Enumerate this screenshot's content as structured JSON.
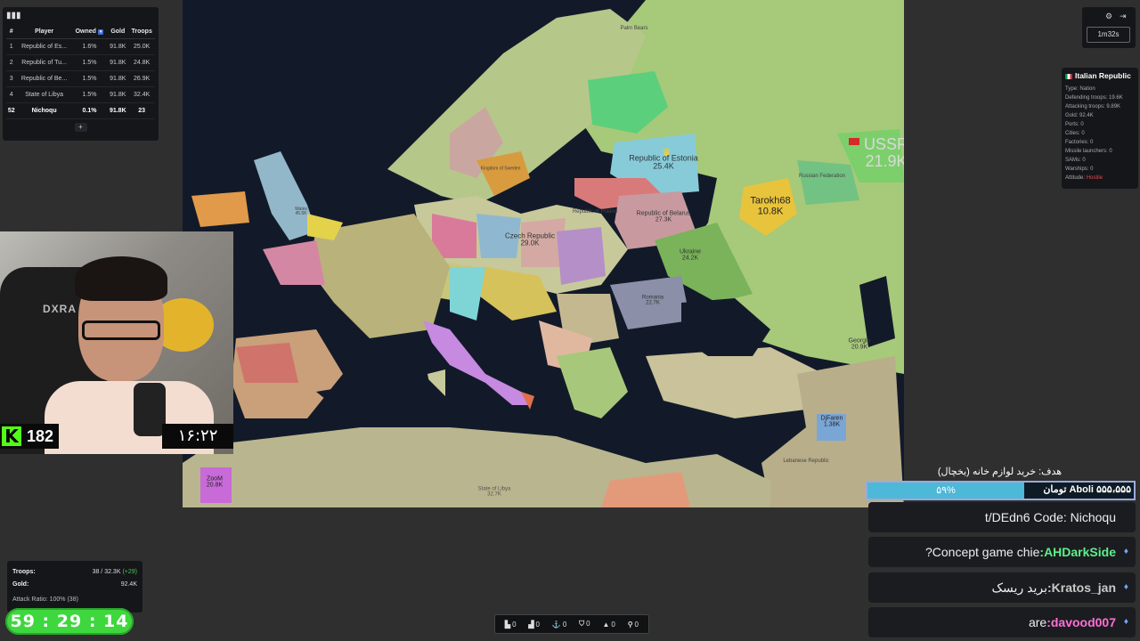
{
  "leaderboard": {
    "headers": {
      "rank": "#",
      "player": "Player",
      "owned": "Owned",
      "gold": "Gold",
      "troops": "Troops"
    },
    "rows": [
      {
        "rank": "1",
        "player": "Republic of Es...",
        "owned": "1.6%",
        "gold": "91.8K",
        "troops": "25.0K"
      },
      {
        "rank": "2",
        "player": "Republic of Tu...",
        "owned": "1.5%",
        "gold": "91.8K",
        "troops": "24.8K"
      },
      {
        "rank": "3",
        "player": "Republic of Be...",
        "owned": "1.5%",
        "gold": "91.8K",
        "troops": "26.9K"
      },
      {
        "rank": "4",
        "player": "State of Libya",
        "owned": "1.5%",
        "gold": "91.8K",
        "troops": "32.4K"
      },
      {
        "rank": "52",
        "player": "Nichoqu",
        "owned": "0.1%",
        "gold": "91.8K",
        "troops": "23"
      }
    ],
    "more": "+"
  },
  "webcam": {
    "kick_count": "182",
    "clock": "۱۶:۲۲",
    "chair_brand": "DXRA"
  },
  "top_controls": {
    "timer": "1m32s"
  },
  "nation_panel": {
    "title": "Italian Republic",
    "rows": [
      "Type: Nation",
      "Defending troops: 19.6K",
      "Attacking troops: 9.89K",
      "Gold: 92.4K",
      "Ports: 0",
      "Cities: 0",
      "Factories: 0",
      "Missile launchers: 0",
      "SAMs: 0",
      "Warships: 0"
    ],
    "attitude_label": "Attitude: ",
    "attitude_value": "Hostile",
    "attitude_color": "#e04848"
  },
  "stats": {
    "troops_label": "Troops:",
    "troops_value": "38 / 32.3K",
    "troops_delta": "(+29)",
    "gold_label": "Gold:",
    "gold_value": "92.4K",
    "attack_ratio": "Attack Ratio: 100% (38)"
  },
  "stream_timer": "59 : 29 : 14",
  "build_bar": [
    {
      "icon": "city-icon",
      "glyph": "▙",
      "count": "0"
    },
    {
      "icon": "factory-icon",
      "glyph": "▟",
      "count": "0"
    },
    {
      "icon": "port-icon",
      "glyph": "⚓",
      "count": "0"
    },
    {
      "icon": "defense-post-icon",
      "glyph": "⛉",
      "count": "0"
    },
    {
      "icon": "missile-silo-icon",
      "glyph": "▲",
      "count": "0"
    },
    {
      "icon": "sam-launcher-icon",
      "glyph": "⚲",
      "count": "0"
    }
  ],
  "goal": {
    "title": "هدف: خرید لوازم خانه (یخچال)",
    "percent": "۵۹%",
    "percent_value": 0.59,
    "amount": "Aboli ۵۵۵،۵۵۵ تومان"
  },
  "chat": [
    {
      "user": "",
      "text": "t/DEdn6 Code: Nichoqu",
      "color": "#eeeeee"
    },
    {
      "user": ":AHDarkSide",
      "text": "?Concept game chie",
      "color": "#5cf08b"
    },
    {
      "user": ":Kratos_jan",
      "text": "برید ریسک",
      "color": "#c9c9c9"
    },
    {
      "user": ":davood007",
      "text": "are",
      "color": "#ff6fd8"
    }
  ],
  "map_labels": [
    {
      "name": "USSR",
      "troops": "21.9K",
      "size": 18,
      "color": "#d9d9d9"
    },
    {
      "name": "Tarokh68",
      "troops": "10.8K",
      "size": 11,
      "color": "#222222"
    },
    {
      "name": "Republic of Estonia",
      "troops": "25.4K",
      "size": 9,
      "color": "#333333"
    },
    {
      "name": "Czech Republic",
      "troops": "29.0K",
      "size": 8,
      "color": "#333333"
    },
    {
      "name": "Republic of Belarus",
      "troops": "27.3K",
      "size": 7,
      "color": "#333333"
    },
    {
      "name": "Ukraine",
      "troops": "24.2K",
      "size": 7,
      "color": "#333333"
    },
    {
      "name": "Georgia",
      "troops": "20.9K",
      "size": 7,
      "color": "#333333"
    },
    {
      "name": "DjFaren",
      "troops": "1.38K",
      "size": 7,
      "color": "#222222"
    },
    {
      "name": "ZooM",
      "troops": "20.8K",
      "size": 7,
      "color": "#222222"
    },
    {
      "name": "Lebanese Republic",
      "troops": "",
      "size": 6,
      "color": "#444444"
    },
    {
      "name": "State of Libya",
      "troops": "32.7K",
      "size": 6,
      "color": "#555555"
    },
    {
      "name": "Romania",
      "troops": "22.7K",
      "size": 6,
      "color": "#333333"
    },
    {
      "name": "Republic of Poland",
      "troops": "",
      "size": 6,
      "color": "#444444"
    },
    {
      "name": "Kingdom of Sweden",
      "troops": "",
      "size": 5,
      "color": "#444444"
    },
    {
      "name": "Palm Bears",
      "troops": "",
      "size": 6,
      "color": "#444444"
    },
    {
      "name": "Russian Federation",
      "troops": "",
      "size": 6,
      "color": "#444444"
    },
    {
      "name": "Wales",
      "troops": "45.5K",
      "size": 5,
      "color": "#444444"
    }
  ]
}
